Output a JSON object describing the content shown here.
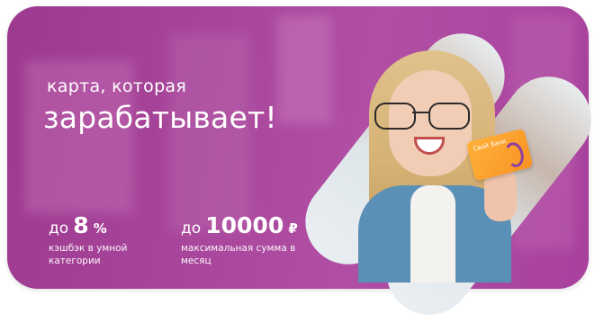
{
  "banner": {
    "headline_small": "карта, которая",
    "headline_big": "зарабатывает!",
    "stats": [
      {
        "prefix": "до",
        "value": "8",
        "unit": "%",
        "caption_line1": "кэшбэк в умной",
        "caption_line2": "категории"
      },
      {
        "prefix": "до",
        "value": "10000",
        "unit": "₽",
        "caption_line1": "максимальная сумма в",
        "caption_line2": "месяц"
      }
    ],
    "card_brand": "Свой Банк",
    "colors": {
      "background": "#a8469c",
      "card": "#ffa62d",
      "text": "#ffffff"
    }
  }
}
